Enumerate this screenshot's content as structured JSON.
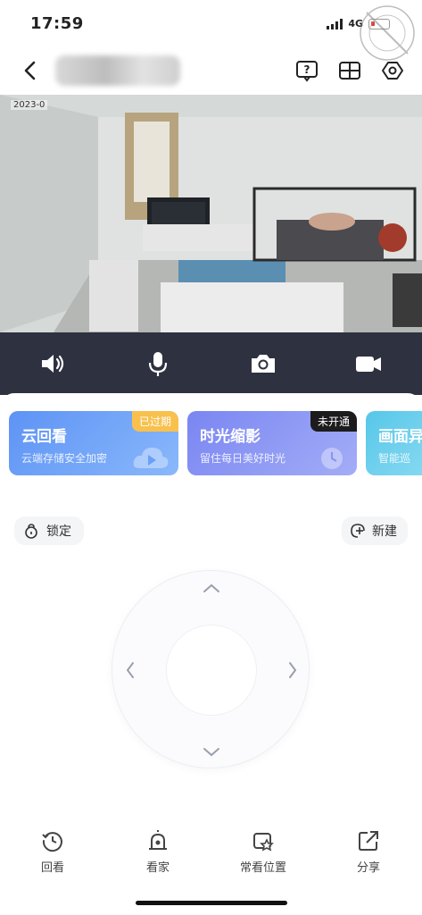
{
  "status_bar": {
    "time": "17:59",
    "network": "4G"
  },
  "header": {
    "device_name": ""
  },
  "video": {
    "timestamp": "2023-0"
  },
  "cards": [
    {
      "title": "云回看",
      "subtitle": "云端存储安全加密",
      "badge": "已过期"
    },
    {
      "title": "时光缩影",
      "subtitle": "留住每日美好时光",
      "badge": "未开通"
    },
    {
      "title": "画面异",
      "subtitle": "智能巡"
    }
  ],
  "controls": {
    "lock_label": "锁定",
    "new_label": "新建"
  },
  "bottom_nav": [
    {
      "label": "回看",
      "icon": "playback-clock-icon"
    },
    {
      "label": "看家",
      "icon": "alarm-light-icon"
    },
    {
      "label": "常看位置",
      "icon": "favorite-position-icon"
    },
    {
      "label": "分享",
      "icon": "share-icon"
    }
  ],
  "colors": {
    "control_bar": "#2e3140",
    "card_cloud": "#5d93f5",
    "card_timelapse": "#7a86f2",
    "card_detect": "#56c7e9",
    "badge_expired": "#f8c14d",
    "badge_inactive": "#1c1c1c",
    "battery_low": "#e53935"
  }
}
